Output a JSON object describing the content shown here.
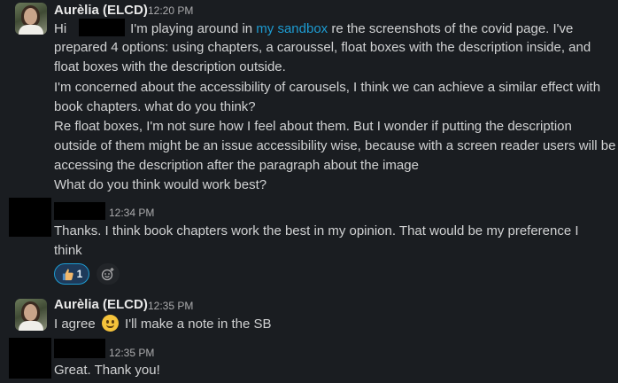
{
  "messages": [
    {
      "sender": "Aurèlia (ELCD)",
      "time": "12:20 PM",
      "lines": {
        "l1_prefix": "Hi",
        "l1_mid": "I'm playing around in ",
        "l1_link": "my sandbox",
        "l1_suffix": " re the screenshots of the covid page. I've",
        "l2": "prepared 4 options: using chapters, a caroussel, float boxes with the description inside, and",
        "l3": "float boxes with the description outside.",
        "l4": "I'm concerned about the accessibility of carousels, I think we can achieve a similar effect with",
        "l5": "book chapters. what do you think?",
        "l6": "Re float boxes, I'm not sure how I feel about them. But I wonder if  putting the description",
        "l7": "outside of them might be an issue accessibility wise, because with a screen reader users will be",
        "l8": "accessing the description after the paragraph about the image",
        "l9": "What do you think would work best?"
      }
    },
    {
      "time": "12:34 PM",
      "lines": {
        "l1": "Thanks. I think book chapters work the best in my opinion. That would be my preference I",
        "l2": "think"
      },
      "reaction": {
        "emoji": "thumbs-up",
        "count": "1"
      }
    },
    {
      "sender": "Aurèlia (ELCD)",
      "time": "12:35 PM",
      "text_before": "I agree",
      "text_after": " I'll make a note in the SB"
    },
    {
      "time": "12:35 PM",
      "text": "Great. Thank you!"
    }
  ],
  "colors": {
    "background": "#1a1d21",
    "link": "#1d9bd1",
    "reaction_bg": "#1e3a5a"
  }
}
